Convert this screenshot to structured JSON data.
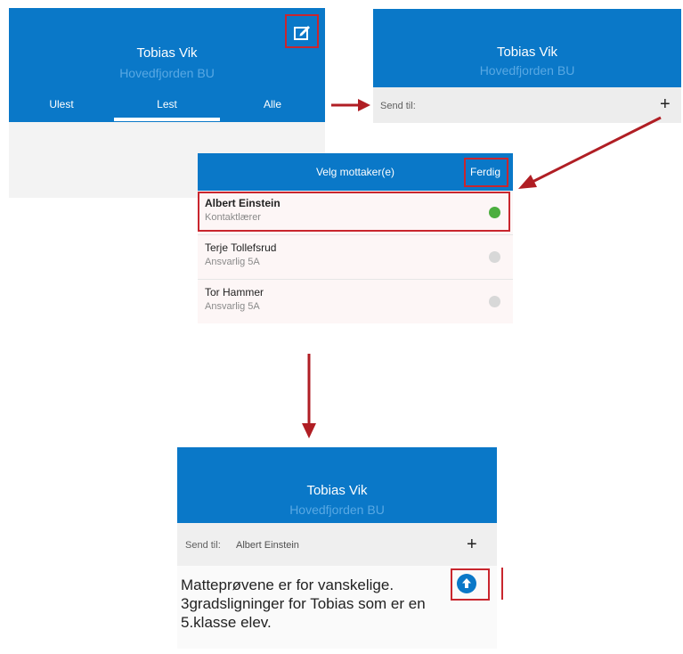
{
  "colors": {
    "primary": "#0a78c8",
    "highlight": "#c9262e",
    "selected": "#4cae3f",
    "unselected": "#d8d8d8"
  },
  "screen1": {
    "name": "Tobias Vik",
    "org": "Hovedfjorden BU",
    "tabs": [
      "Ulest",
      "Lest",
      "Alle"
    ],
    "compose_icon": "compose-icon"
  },
  "screen2": {
    "name": "Tobias Vik",
    "org": "Hovedfjorden BU",
    "send_label": "Send til:",
    "plus": "+"
  },
  "screen3": {
    "title": "Velg mottaker(e)",
    "done": "Ferdig",
    "recipients": [
      {
        "name": "Albert Einstein",
        "role": "Kontaktlærer",
        "selected": true
      },
      {
        "name": "Terje Tollefsrud",
        "role": "Ansvarlig 5A",
        "selected": false
      },
      {
        "name": "Tor Hammer",
        "role": "Ansvarlig 5A",
        "selected": false
      }
    ]
  },
  "screen4": {
    "name": "Tobias Vik",
    "org": "Hovedfjorden BU",
    "send_label": "Send til:",
    "recipient": "Albert Einstein",
    "plus": "+",
    "message": "Matteprøvene er for vanskelige. 3gradsligninger for Tobias som er en 5.klasse elev.",
    "send_icon": "arrow-up-icon"
  }
}
